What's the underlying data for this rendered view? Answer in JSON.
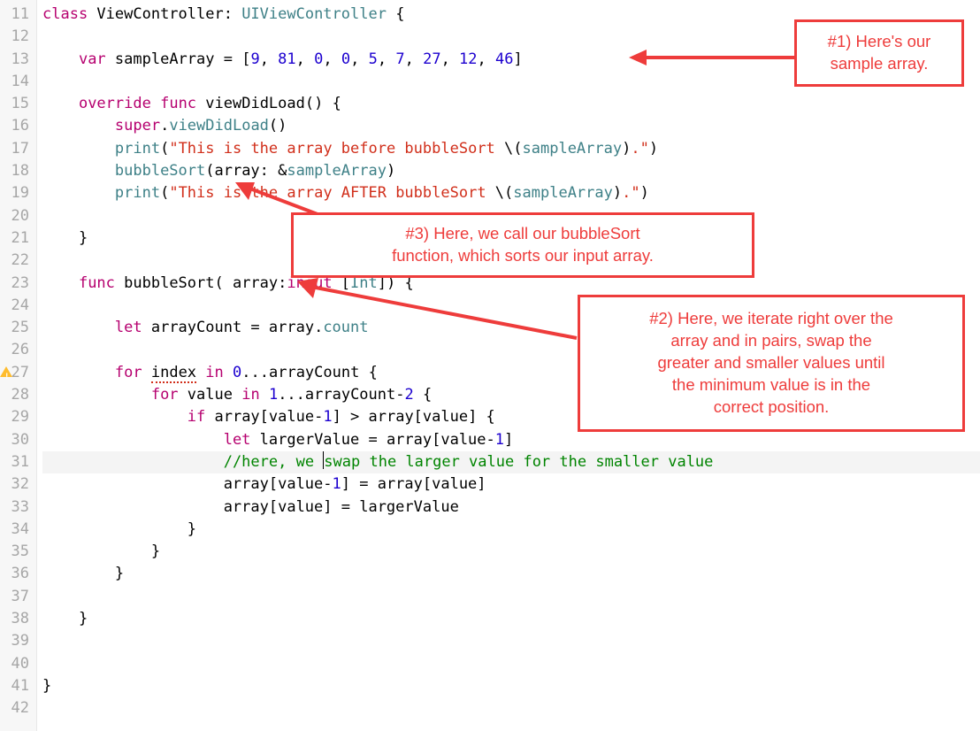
{
  "gutter": {
    "start": 11,
    "end": 42,
    "warning_line": 27,
    "current_line": 31
  },
  "annotations": {
    "a1": "#1) Here's our\nsample array.",
    "a2": "#2) Here, we iterate right over the\narray and in pairs, swap the\ngreater and smaller values until\nthe minimum value is in the\ncorrect position.",
    "a3": "#3) Here, we call our bubbleSort\nfunction, which sorts our input array."
  },
  "code": {
    "l11": [
      [
        "kw",
        "class"
      ],
      [
        "",
        " ViewController: "
      ],
      [
        "type",
        "UIViewController"
      ],
      [
        "",
        " {"
      ]
    ],
    "l12": [],
    "l13": [
      [
        "",
        "    "
      ],
      [
        "kw",
        "var"
      ],
      [
        "",
        " sampleArray = ["
      ],
      [
        "num",
        "9"
      ],
      [
        "",
        ", "
      ],
      [
        "num",
        "81"
      ],
      [
        "",
        ", "
      ],
      [
        "num",
        "0"
      ],
      [
        "",
        ", "
      ],
      [
        "num",
        "0"
      ],
      [
        "",
        ", "
      ],
      [
        "num",
        "5"
      ],
      [
        "",
        ", "
      ],
      [
        "num",
        "7"
      ],
      [
        "",
        ", "
      ],
      [
        "num",
        "27"
      ],
      [
        "",
        ", "
      ],
      [
        "num",
        "12"
      ],
      [
        "",
        ", "
      ],
      [
        "num",
        "46"
      ],
      [
        "",
        "]"
      ]
    ],
    "l14": [],
    "l15": [
      [
        "",
        "    "
      ],
      [
        "kw",
        "override"
      ],
      [
        "",
        " "
      ],
      [
        "kw",
        "func"
      ],
      [
        "",
        " viewDidLoad() {"
      ]
    ],
    "l16": [
      [
        "",
        "        "
      ],
      [
        "kw",
        "super"
      ],
      [
        "",
        "."
      ],
      [
        "call",
        "viewDidLoad"
      ],
      [
        "",
        "()"
      ]
    ],
    "l17": [
      [
        "",
        "        "
      ],
      [
        "call",
        "print"
      ],
      [
        "",
        "("
      ],
      [
        "string",
        "\"This is the array before bubbleSort "
      ],
      [
        "escape",
        "\\("
      ],
      [
        "interp",
        "sampleArray"
      ],
      [
        "escape",
        ")"
      ],
      [
        "string",
        ".\""
      ],
      [
        "",
        ")"
      ]
    ],
    "l18": [
      [
        "",
        "        "
      ],
      [
        "call",
        "bubbleSort"
      ],
      [
        "",
        "(array: &"
      ],
      [
        "interp",
        "sampleArray"
      ],
      [
        "",
        ")"
      ]
    ],
    "l19": [
      [
        "",
        "        "
      ],
      [
        "call",
        "print"
      ],
      [
        "",
        "("
      ],
      [
        "string",
        "\"This is the array AFTER bubbleSort "
      ],
      [
        "escape",
        "\\("
      ],
      [
        "interp",
        "sampleArray"
      ],
      [
        "escape",
        ")"
      ],
      [
        "string",
        ".\""
      ],
      [
        "",
        ")"
      ]
    ],
    "l20": [],
    "l21": [
      [
        "",
        "    }"
      ]
    ],
    "l22": [],
    "l23": [
      [
        "",
        "    "
      ],
      [
        "kw",
        "func"
      ],
      [
        "",
        " bubbleSort( array:"
      ],
      [
        "kw",
        "inout"
      ],
      [
        "",
        " ["
      ],
      [
        "type",
        "Int"
      ],
      [
        "",
        "]) {"
      ]
    ],
    "l24": [],
    "l25": [
      [
        "",
        "        "
      ],
      [
        "kw",
        "let"
      ],
      [
        "",
        " arrayCount = array."
      ],
      [
        "call",
        "count"
      ]
    ],
    "l26": [],
    "l27": [
      [
        "",
        "        "
      ],
      [
        "kw",
        "for"
      ],
      [
        "",
        " "
      ],
      [
        "dotted-red",
        "index"
      ],
      [
        "",
        " "
      ],
      [
        "kw",
        "in"
      ],
      [
        "",
        " "
      ],
      [
        "num",
        "0"
      ],
      [
        "",
        "...arrayCount {"
      ]
    ],
    "l28": [
      [
        "",
        "            "
      ],
      [
        "kw",
        "for"
      ],
      [
        "",
        " value "
      ],
      [
        "kw",
        "in"
      ],
      [
        "",
        " "
      ],
      [
        "num",
        "1"
      ],
      [
        "",
        "...arrayCount-"
      ],
      [
        "num",
        "2"
      ],
      [
        "",
        " {"
      ]
    ],
    "l29": [
      [
        "",
        "                "
      ],
      [
        "kw",
        "if"
      ],
      [
        "",
        " array[value-"
      ],
      [
        "num",
        "1"
      ],
      [
        "",
        "] > array[value] {"
      ]
    ],
    "l30": [
      [
        "",
        "                    "
      ],
      [
        "kw",
        "let"
      ],
      [
        "",
        " largerValue = array[value-"
      ],
      [
        "num",
        "1"
      ],
      [
        "",
        "]"
      ]
    ],
    "l31": [
      [
        "",
        "                    "
      ],
      [
        "cmt",
        "//here, we "
      ],
      [
        "cursor",
        ""
      ],
      [
        "cmt",
        "swap the larger value for the smaller value"
      ]
    ],
    "l32": [
      [
        "",
        "                    array[value-"
      ],
      [
        "num",
        "1"
      ],
      [
        "",
        "] = array[value]"
      ]
    ],
    "l33": [
      [
        "",
        "                    array[value] = largerValue"
      ]
    ],
    "l34": [
      [
        "",
        "                }"
      ]
    ],
    "l35": [
      [
        "",
        "            }"
      ]
    ],
    "l36": [
      [
        "",
        "        }"
      ]
    ],
    "l37": [],
    "l38": [
      [
        "",
        "    }"
      ]
    ],
    "l39": [],
    "l40": [],
    "l41": [
      [
        "",
        "}"
      ]
    ],
    "l42": []
  }
}
